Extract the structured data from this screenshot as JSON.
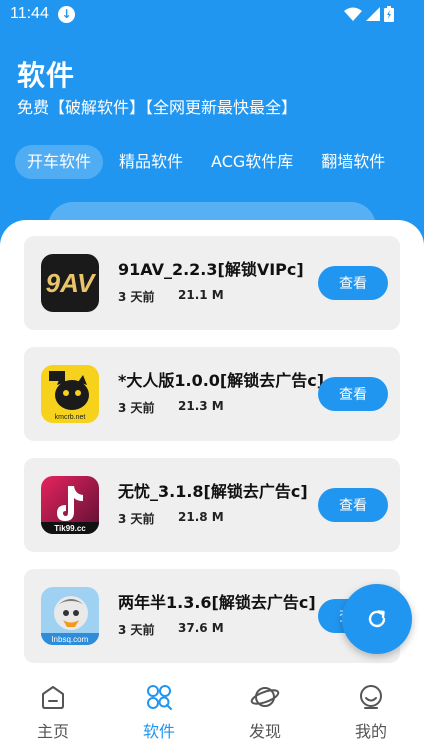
{
  "status_bar": {
    "time": "11:44"
  },
  "header": {
    "title": "软件",
    "subtitle": "免费【破解软件】【全网更新最快最全】"
  },
  "tabs": [
    {
      "label": "开车软件",
      "active": true
    },
    {
      "label": "精品软件",
      "active": false
    },
    {
      "label": "ACG软件库",
      "active": false
    },
    {
      "label": "翻墙软件",
      "active": false
    }
  ],
  "apps": [
    {
      "name": "91AV_2.2.3[解锁VIPc]",
      "time": "3 天前",
      "size": "21.1 M",
      "button": "查看",
      "icon_text": "9AV"
    },
    {
      "name": "*大人版1.0.0[解锁去广告c]",
      "time": "3 天前",
      "size": "21.3 M",
      "button": "查看",
      "icon_text": "kmcrb.net"
    },
    {
      "name": "无忧_3.1.8[解锁去广告c]",
      "time": "3 天前",
      "size": "21.8 M",
      "button": "查看",
      "icon_text": "Tik99.cc"
    },
    {
      "name": "两年半1.3.6[解锁去广告c]",
      "time": "3 天前",
      "size": "37.6 M",
      "button": "查看",
      "icon_text": "lnbsq.com"
    }
  ],
  "bottom_nav": [
    {
      "label": "主页",
      "icon": "home-icon",
      "active": false
    },
    {
      "label": "软件",
      "icon": "apps-icon",
      "active": true
    },
    {
      "label": "发现",
      "icon": "planet-icon",
      "active": false
    },
    {
      "label": "我的",
      "icon": "profile-icon",
      "active": false
    }
  ],
  "colors": {
    "primary": "#2196f0",
    "card_bg": "#efefef"
  }
}
